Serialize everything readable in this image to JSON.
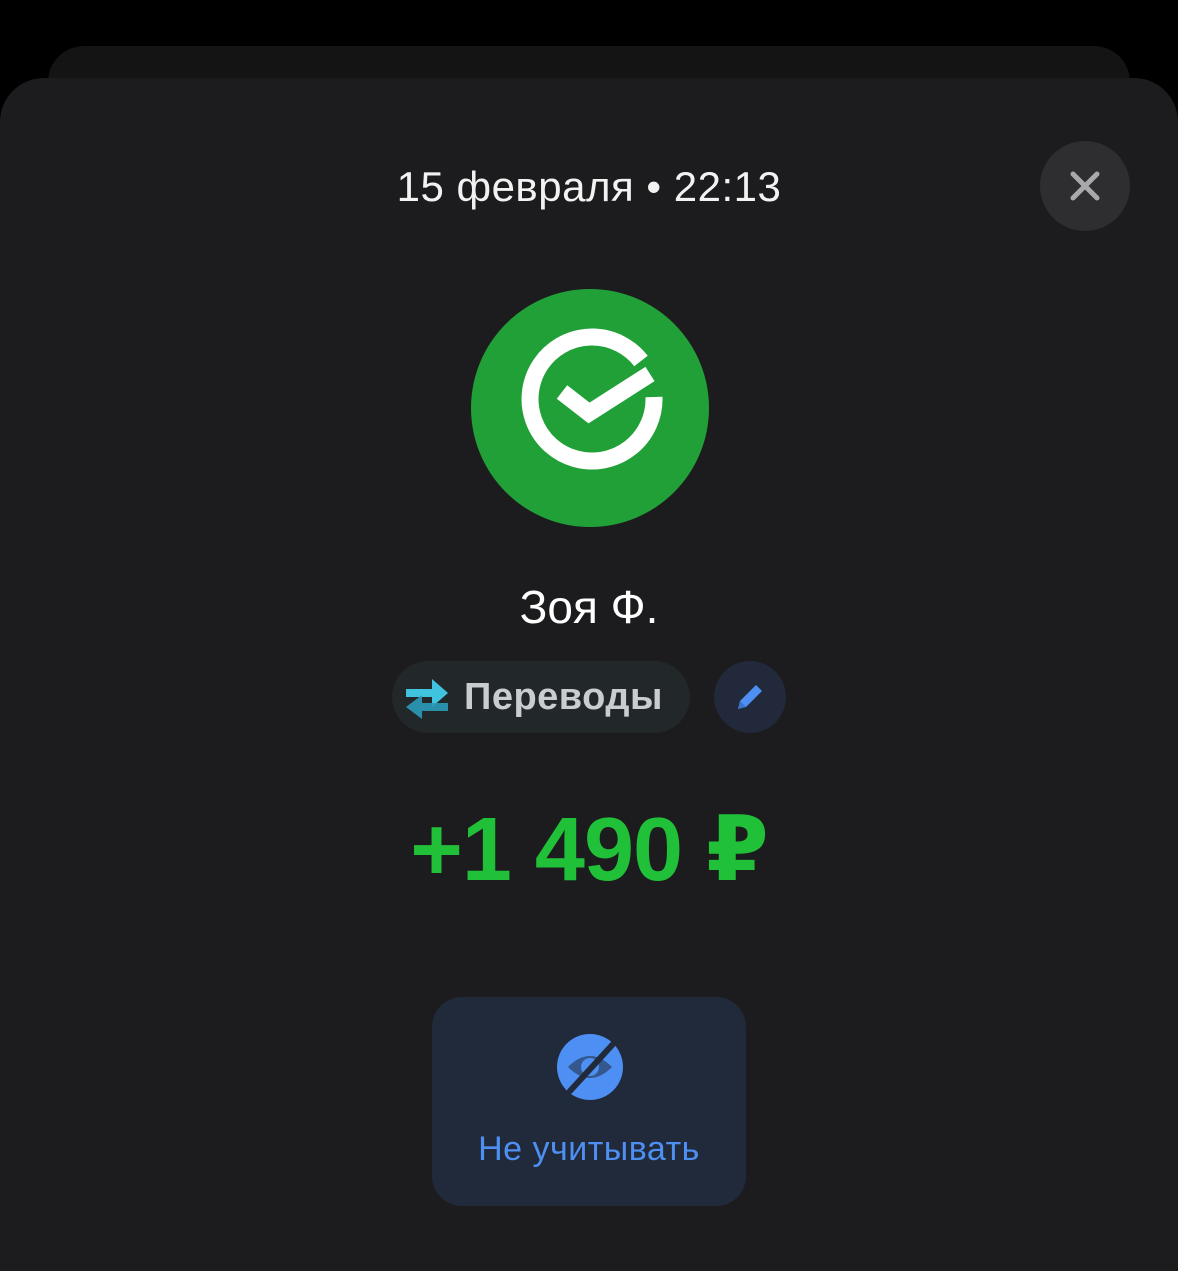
{
  "header": {
    "datetime": "15 февраля • 22:13"
  },
  "icons": {
    "close": "close-icon",
    "logo": "sber-check-logo-icon",
    "category": "transfer-arrows-icon",
    "edit": "pencil-icon",
    "exclude": "eye-slash-icon"
  },
  "transaction": {
    "counterparty": "Зоя Ф.",
    "category": "Переводы",
    "amount": "+1 490 ₽"
  },
  "actions": {
    "exclude_label": "Не учитывать"
  },
  "colors": {
    "background": "#1c1c1e",
    "amount_green": "#21c039",
    "logo_green": "#21a038",
    "accent_blue": "#4d8ff2"
  }
}
